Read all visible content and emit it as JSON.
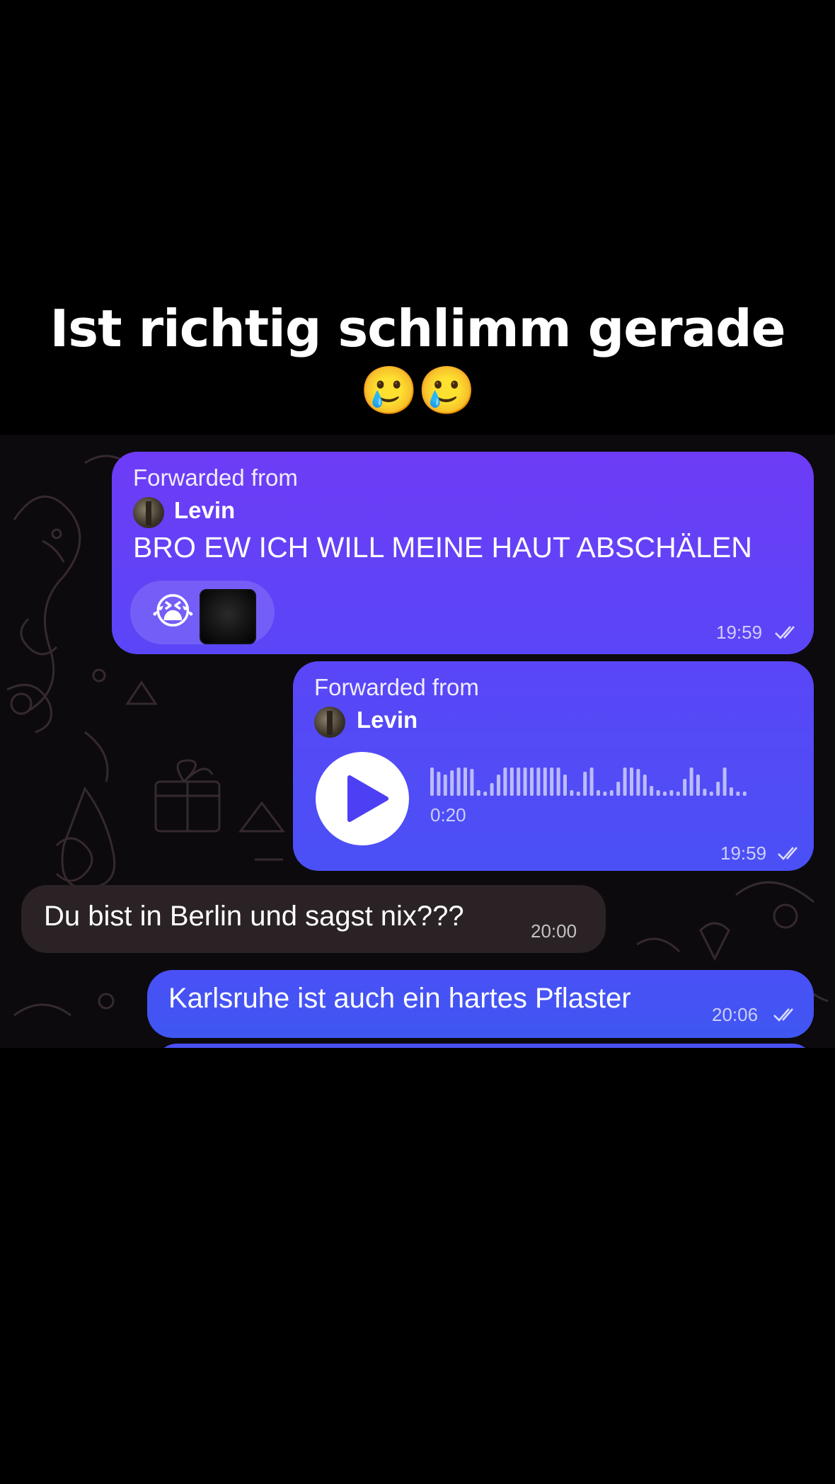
{
  "caption": {
    "line1": "Ist richtig schlimm gerade",
    "line2": "🥲🥲"
  },
  "messages": [
    {
      "forwarded_label": "Forwarded from",
      "forwarded_name": "Levin",
      "text": "BRO EW ICH WILL MEINE HAUT ABSCHÄLEN",
      "reaction_emoji": "😭",
      "time": "19:59"
    },
    {
      "forwarded_label": "Forwarded from",
      "forwarded_name": "Levin",
      "voice_duration": "0:20",
      "time": "19:59"
    },
    {
      "text": "Du bist in Berlin und sagst nix???",
      "time": "20:00"
    },
    {
      "text": "Karlsruhe ist auch ein hartes Pflaster",
      "time": "20:06"
    }
  ],
  "icons": {
    "read_status": "double-check-icon",
    "play": "play-icon"
  },
  "colors": {
    "outgoing_top": "#6e3cf6",
    "outgoing_bottom": "#3f57f2",
    "incoming": "#2a2224",
    "background": "#000000"
  }
}
